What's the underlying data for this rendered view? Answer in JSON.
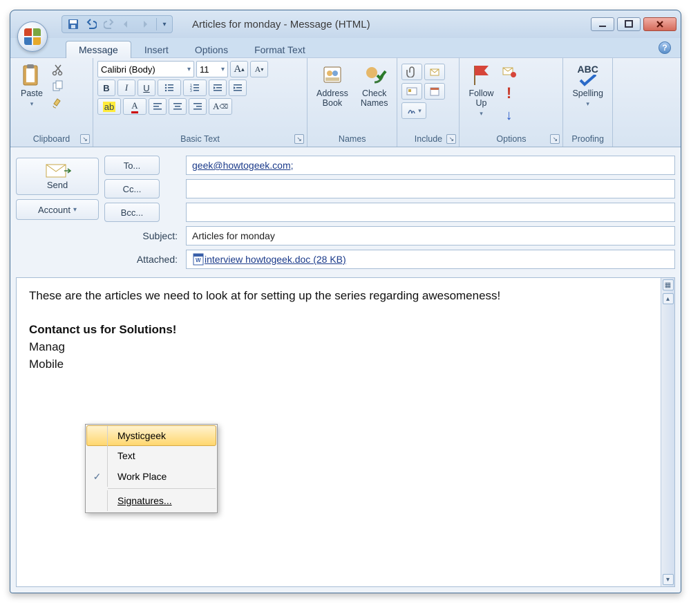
{
  "window": {
    "title": "Articles for monday - Message (HTML)"
  },
  "tabs": {
    "message": "Message",
    "insert": "Insert",
    "options": "Options",
    "formattext": "Format Text"
  },
  "ribbon": {
    "clipboard": {
      "label": "Clipboard",
      "paste": "Paste"
    },
    "basictext": {
      "label": "Basic Text",
      "font": "Calibri (Body)",
      "size": "11"
    },
    "names": {
      "label": "Names",
      "address": "Address\nBook",
      "check": "Check\nNames"
    },
    "include": {
      "label": "Include"
    },
    "options": {
      "label": "Options",
      "follow": "Follow\nUp"
    },
    "proofing": {
      "label": "Proofing",
      "spelling": "Spelling"
    }
  },
  "compose": {
    "send": "Send",
    "account": "Account",
    "to_btn": "To...",
    "cc_btn": "Cc...",
    "bcc_btn": "Bcc...",
    "subject_lbl": "Subject:",
    "attached_lbl": "Attached:",
    "to_val": "geek@howtogeek.com;",
    "cc_val": "",
    "bcc_val": "",
    "subject_val": "Articles for monday",
    "attachment_name": "interview howtogeek.doc (28 KB)"
  },
  "body": {
    "para1": "These are the articles we need to look at for setting up the series regarding awesomeness!",
    "heading": "Contanct us for Solutions!",
    "line3": "Manag",
    "line4": "Mobile"
  },
  "contextmenu": {
    "item1": "Mysticgeek",
    "item2": "Text",
    "item3": "Work Place",
    "item4": "Signatures..."
  }
}
